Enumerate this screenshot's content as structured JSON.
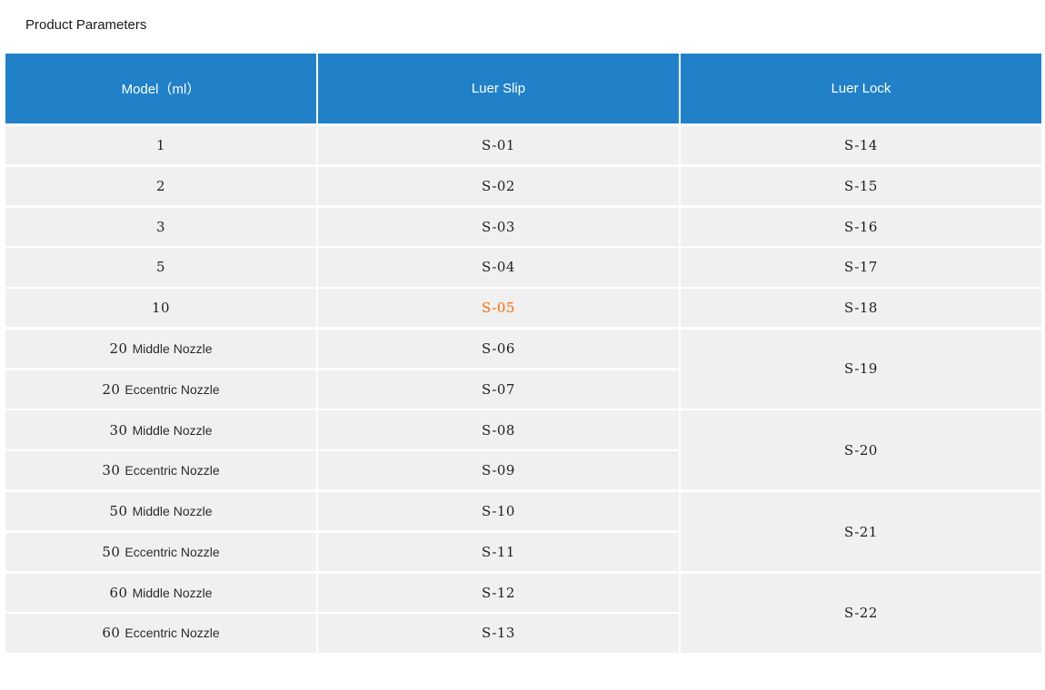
{
  "page": {
    "title": "Product Parameters"
  },
  "colors": {
    "header_bg": "#2080c8",
    "header_text": "#ffffff",
    "row_bg": "#f0f0f0",
    "body_text": "#1f1f1f",
    "highlight_orange": "#ff6600"
  },
  "table": {
    "columns": [
      {
        "label": "Model（ml）"
      },
      {
        "label": "Luer Slip"
      },
      {
        "label": "Luer Lock"
      }
    ],
    "rows": [
      {
        "model_num": "1",
        "model_label": "",
        "luer_slip": "S-01",
        "highlight": false
      },
      {
        "model_num": "2",
        "model_label": "",
        "luer_slip": "S-02",
        "highlight": false
      },
      {
        "model_num": "3",
        "model_label": "",
        "luer_slip": "S-03",
        "highlight": false
      },
      {
        "model_num": "5",
        "model_label": "",
        "luer_slip": "S-04",
        "highlight": false
      },
      {
        "model_num": "10",
        "model_label": "",
        "luer_slip": "S-05",
        "highlight": true
      },
      {
        "model_num": "20",
        "model_label": "Middle Nozzle",
        "luer_slip": "S-06",
        "highlight": false
      },
      {
        "model_num": "20",
        "model_label": "Eccentric Nozzle",
        "luer_slip": "S-07",
        "highlight": false
      },
      {
        "model_num": "30",
        "model_label": "Middle Nozzle",
        "luer_slip": "S-08",
        "highlight": false
      },
      {
        "model_num": "30",
        "model_label": "Eccentric Nozzle",
        "luer_slip": "S-09",
        "highlight": false
      },
      {
        "model_num": "50",
        "model_label": "Middle Nozzle",
        "luer_slip": "S-10",
        "highlight": false
      },
      {
        "model_num": "50",
        "model_label": "Eccentric Nozzle",
        "luer_slip": "S-11",
        "highlight": false
      },
      {
        "model_num": "60",
        "model_label": "Middle Nozzle",
        "luer_slip": "S-12",
        "highlight": false
      },
      {
        "model_num": "60",
        "model_label": "Eccentric Nozzle",
        "luer_slip": "S-13",
        "highlight": false
      }
    ],
    "luer_lock_cells": [
      {
        "label": "S-14",
        "span": 1
      },
      {
        "label": "S-15",
        "span": 1
      },
      {
        "label": "S-16",
        "span": 1
      },
      {
        "label": "S-17",
        "span": 1
      },
      {
        "label": "S-18",
        "span": 1
      },
      {
        "label": "S-19",
        "span": 2
      },
      {
        "label": "S-20",
        "span": 2
      },
      {
        "label": "S-21",
        "span": 2
      },
      {
        "label": "S-22",
        "span": 2
      }
    ]
  }
}
